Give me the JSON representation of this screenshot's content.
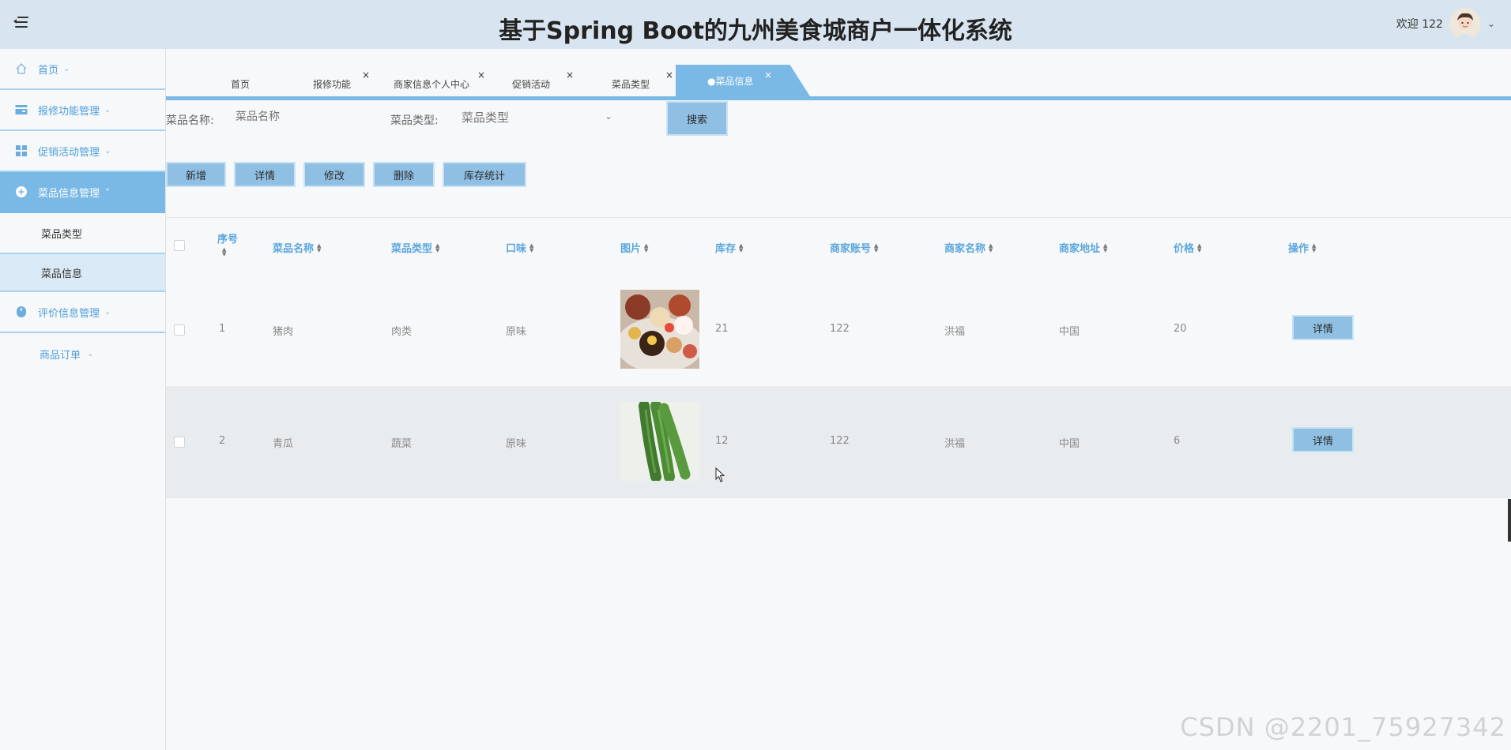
{
  "header": {
    "title": "基于Spring Boot的九州美食城商户一体化系统",
    "welcome": "欢迎 122",
    "menu_icon": "menu-fold-icon",
    "avatar_icon": "user-avatar"
  },
  "sidebar": {
    "items": [
      {
        "label": "首页",
        "icon": "home-icon"
      },
      {
        "label": "报修功能管理",
        "icon": "card-icon"
      },
      {
        "label": "促销活动管理",
        "icon": "grid-icon"
      },
      {
        "label": "菜品信息管理",
        "icon": "circle-plus-icon"
      },
      {
        "label": "菜品类型"
      },
      {
        "label": "菜品信息"
      },
      {
        "label": "评价信息管理",
        "icon": "mouse-icon"
      },
      {
        "label": "商品订单"
      }
    ]
  },
  "tabs": [
    {
      "label": "首页"
    },
    {
      "label": "报修功能"
    },
    {
      "label": "商家信息个人中心"
    },
    {
      "label": "促销活动"
    },
    {
      "label": "菜品类型"
    },
    {
      "label": "●菜品信息"
    }
  ],
  "tab_close": "×",
  "search": {
    "name_label": "菜品名称:",
    "name_placeholder": "菜品名称",
    "type_label": "菜品类型:",
    "type_placeholder": "菜品类型",
    "button": "搜索"
  },
  "actions": [
    "新增",
    "详情",
    "修改",
    "删除",
    "库存统计"
  ],
  "table": {
    "columns": [
      "序号",
      "菜品名称",
      "菜品类型",
      "口味",
      "图片",
      "库存",
      "商家账号",
      "商家名称",
      "商家地址",
      "价格",
      "操作"
    ],
    "rows": [
      {
        "index": "1",
        "name": "猪肉",
        "type": "肉类",
        "flavor": "原味",
        "image": "dessert-photo",
        "stock": "21",
        "account": "122",
        "merchant": "洪福",
        "address": "中国",
        "price": "20",
        "action": "详情"
      },
      {
        "index": "2",
        "name": "青瓜",
        "type": "蔬菜",
        "flavor": "原味",
        "image": "cucumber-photo",
        "stock": "12",
        "account": "122",
        "merchant": "洪福",
        "address": "中国",
        "price": "6",
        "action": "详情"
      }
    ]
  },
  "watermark": "CSDN @2201_75927342",
  "colors": {
    "header_bg": "#d8e4ef",
    "accent": "#7ab8e6",
    "link_blue": "#4b9fdc",
    "button_bg": "#8fbfe3",
    "row_alt": "#e9ecef"
  }
}
